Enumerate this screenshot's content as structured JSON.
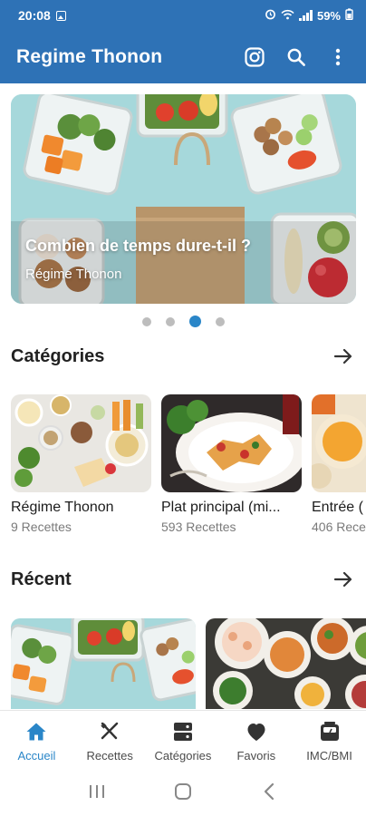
{
  "status_bar": {
    "time": "20:08",
    "battery": "59%",
    "icons": [
      "photo-icon",
      "alarm-icon",
      "wifi-icon",
      "signal-icon",
      "battery-icon"
    ]
  },
  "app_bar": {
    "title": "Regime Thonon",
    "actions": [
      "instagram-icon",
      "search-icon",
      "more-vert-icon"
    ]
  },
  "carousel": {
    "title": "Combien de temps dure-t-il ?",
    "subtitle": "Régime Thonon",
    "slides_count": 4,
    "active_index": 2
  },
  "categories": {
    "title": "Catégories",
    "items": [
      {
        "name": "Régime Thonon",
        "count": "9 Recettes"
      },
      {
        "name": "Plat principal (mi...",
        "count": "593 Recettes"
      },
      {
        "name": "Entrée (",
        "count": "406 Rece"
      }
    ]
  },
  "recent": {
    "title": "Récent"
  },
  "bottom_nav": {
    "items": [
      {
        "label": "Accueil",
        "icon": "home-icon",
        "active": true
      },
      {
        "label": "Recettes",
        "icon": "fork-knife-icon",
        "active": false
      },
      {
        "label": "Catégories",
        "icon": "categories-icon",
        "active": false
      },
      {
        "label": "Favoris",
        "icon": "heart-icon",
        "active": false
      },
      {
        "label": "IMC/BMI",
        "icon": "scale-icon",
        "active": false
      }
    ]
  },
  "colors": {
    "primary": "#2e72b6",
    "accent": "#2a86c8",
    "text": "#1c1c1c",
    "muted": "#7a7a7a"
  }
}
